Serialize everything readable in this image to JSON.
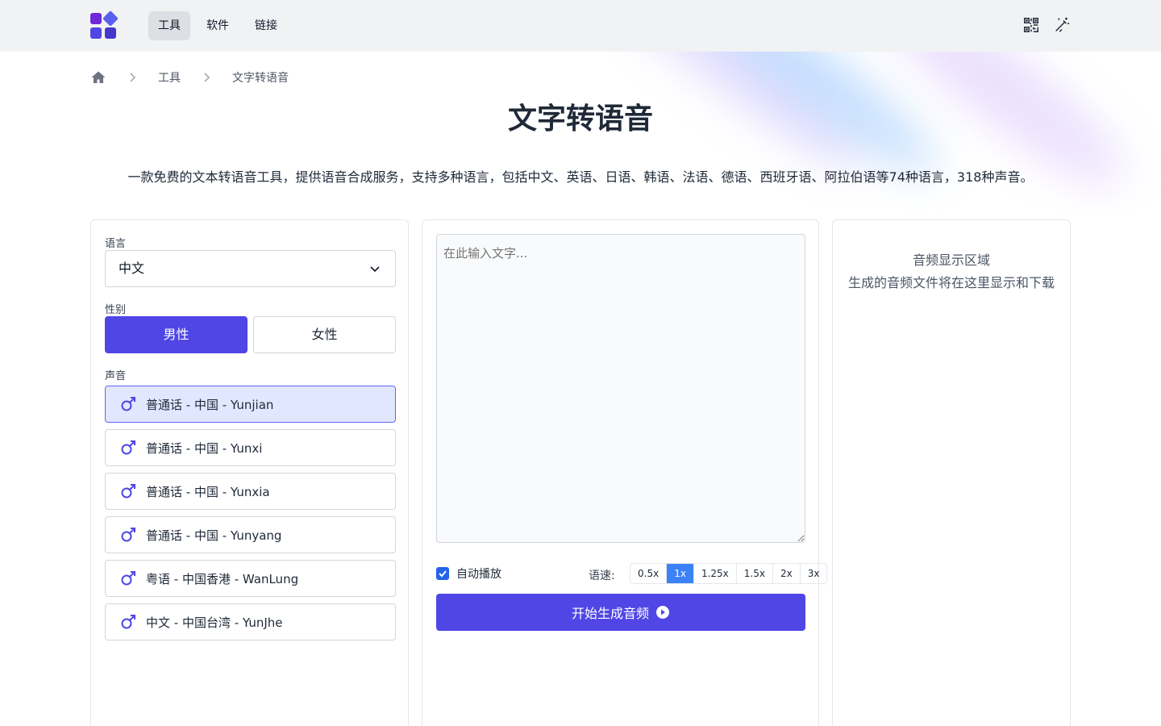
{
  "nav": {
    "items": [
      {
        "label": "工具",
        "active": true
      },
      {
        "label": "软件",
        "active": false
      },
      {
        "label": "链接",
        "active": false
      }
    ],
    "icons": [
      "qrcode-icon",
      "magic-wand-icon"
    ]
  },
  "breadcrumb": {
    "home_icon": "home-icon",
    "items": [
      "工具",
      "文字转语音"
    ]
  },
  "page": {
    "title": "文字转语音",
    "description": "一款免费的文本转语音工具，提供语音合成服务，支持多种语言，包括中文、英语、日语、韩语、法语、德语、西班牙语、阿拉伯语等74种语言，318种声音。"
  },
  "settings": {
    "language_label": "语言",
    "language_value": "中文",
    "gender_label": "性别",
    "gender_male": "男性",
    "gender_female": "女性",
    "gender_selected": "male",
    "voice_label": "声音",
    "voices": [
      {
        "label": "普通话 - 中国 - Yunjian",
        "selected": true
      },
      {
        "label": "普通话 - 中国 - Yunxi",
        "selected": false
      },
      {
        "label": "普通话 - 中国 - Yunxia",
        "selected": false
      },
      {
        "label": "普通话 - 中国 - Yunyang",
        "selected": false
      },
      {
        "label": "粤语 - 中国香港 - WanLung",
        "selected": false
      },
      {
        "label": "中文 - 中国台湾 - YunJhe",
        "selected": false
      }
    ]
  },
  "editor": {
    "placeholder": "在此输入文字...",
    "autoplay_label": "自动播放",
    "autoplay_checked": true,
    "speed_label": "语速:",
    "speeds": [
      "0.5x",
      "1x",
      "1.25x",
      "1.5x",
      "2x",
      "3x"
    ],
    "speed_selected": "1x",
    "generate_label": "开始生成音频"
  },
  "audio": {
    "title": "音频显示区域",
    "subtitle": "生成的音频文件将在这里显示和下载"
  },
  "colors": {
    "accent": "#4f46e5",
    "speed_active": "#3b82f6",
    "checkbox": "#2563eb",
    "selected_voice_bg": "#e0e7ff"
  }
}
